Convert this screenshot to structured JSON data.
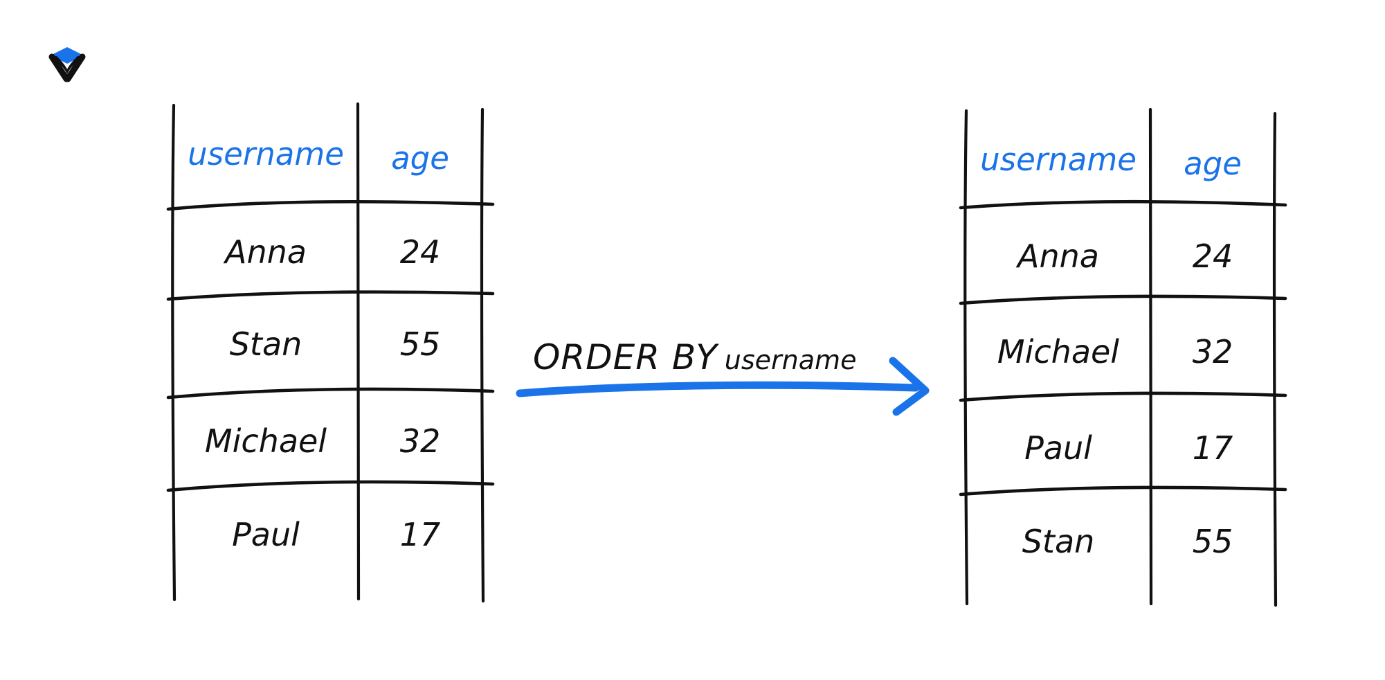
{
  "logo": {
    "name": "x-diamond-logo",
    "letter": "X",
    "accent_color": "#1A73E8",
    "ink_color": "#111111"
  },
  "colors": {
    "header_blue": "#1A73E8",
    "arrow_blue": "#1A73E8",
    "ink": "#111111",
    "background": "#FFFFFF"
  },
  "diagram": {
    "type": "sql-order-by-illustration",
    "operation_label": {
      "keyword": "ORDER BY",
      "column": "username"
    },
    "arrow": {
      "name": "order-by-arrow",
      "direction": "right",
      "color": "#1A73E8"
    }
  },
  "source_table": {
    "name": "source-table",
    "columns": [
      "username",
      "age"
    ],
    "rows": [
      {
        "username": "Anna",
        "age": "24"
      },
      {
        "username": "Stan",
        "age": "55"
      },
      {
        "username": "Michael",
        "age": "32"
      },
      {
        "username": "Paul",
        "age": "17"
      }
    ]
  },
  "result_table": {
    "name": "result-table",
    "columns": [
      "username",
      "age"
    ],
    "rows": [
      {
        "username": "Anna",
        "age": "24"
      },
      {
        "username": "Michael",
        "age": "32"
      },
      {
        "username": "Paul",
        "age": "17"
      },
      {
        "username": "Stan",
        "age": "55"
      }
    ]
  }
}
